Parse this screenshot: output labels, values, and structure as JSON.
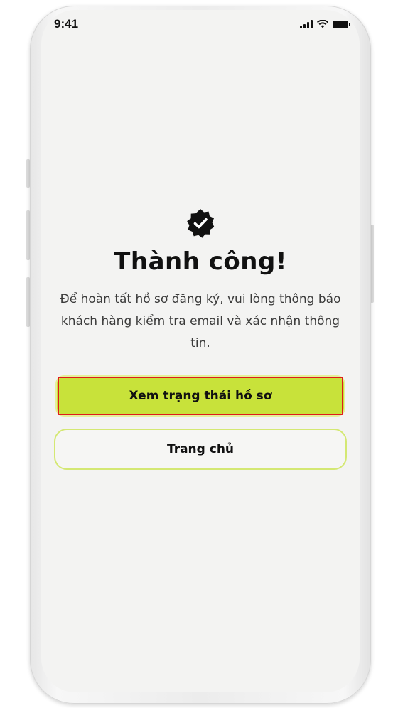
{
  "status_bar": {
    "time": "9:41",
    "icons": [
      "cellular-signal-icon",
      "wifi-icon",
      "battery-icon"
    ]
  },
  "success": {
    "badge_icon": "verified-badge-check-icon",
    "title": "Thành công!",
    "message": "Để hoàn tất hồ sơ đăng ký, vui lòng thông báo khách hàng kiểm tra email và xác nhận thông tin."
  },
  "actions": {
    "primary_label": "Xem trạng thái hồ sơ",
    "secondary_label": "Trang chủ"
  },
  "colors": {
    "accent": "#c8e23a",
    "highlight_border": "#e01b1b",
    "screen_background": "#f3f3f2",
    "text": "#111111"
  }
}
